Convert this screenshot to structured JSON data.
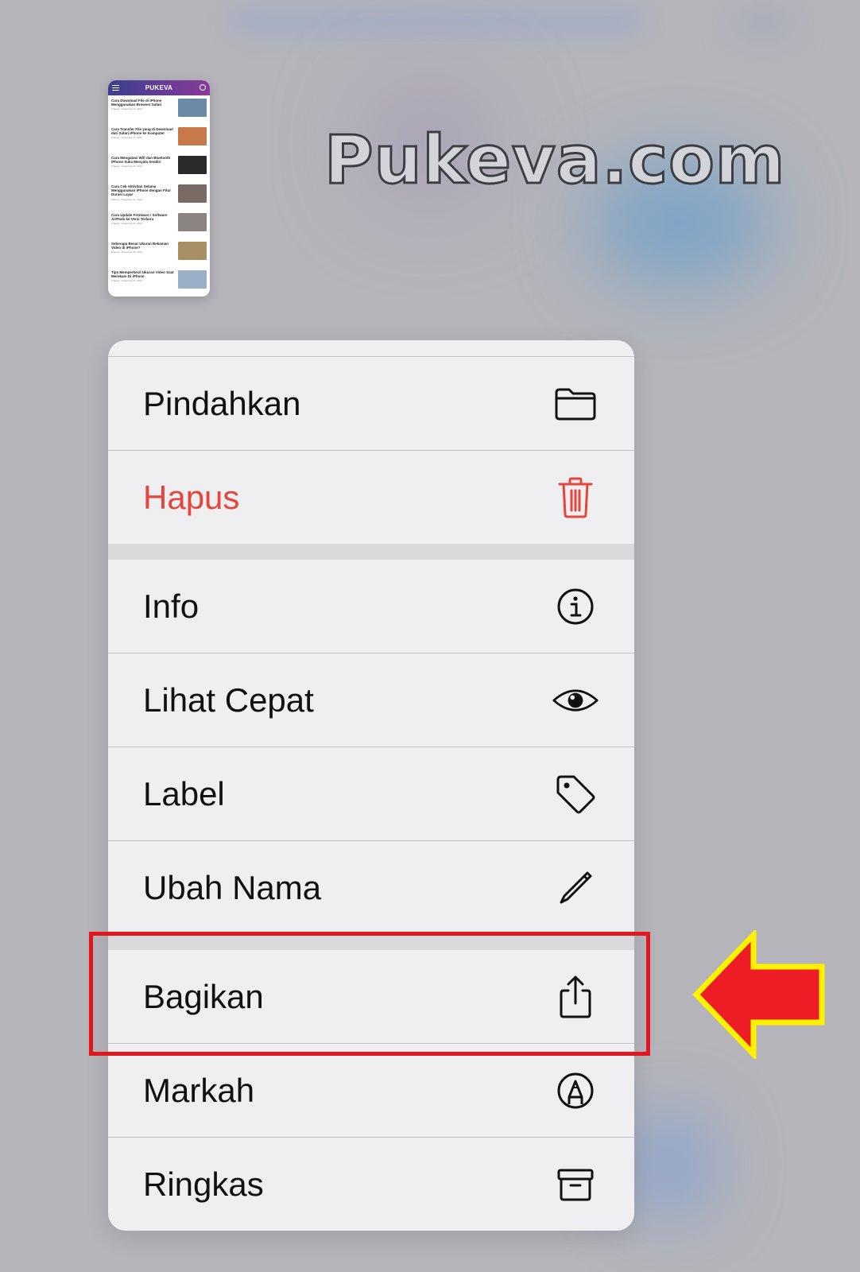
{
  "watermark": "Pukeva.com",
  "thumbnail": {
    "site_name": "PUKEVA",
    "articles": [
      {
        "title": "Cara Download File di iPhone Menggunakan Browser Safari",
        "meta": "Pukeva · Desember 24, 2021",
        "color": "#6a8aa8"
      },
      {
        "title": "Cara Transfer File yang di Download dari Safari iPhone ke Komputer",
        "meta": "Pukeva · Desember 24, 2021",
        "color": "#c8794a"
      },
      {
        "title": "Cara Mengatasi Wifi dan Bluetooth iPhone Suka Menyala Sendiri",
        "meta": "Pukeva · Desember 22, 2021",
        "color": "#2a2a2a"
      },
      {
        "title": "Cara Cek Aktivitas Selama Menggunakan iPhone dengan Fitur Durasi Layar",
        "meta": "Pukeva · Desember 21, 2021",
        "color": "#7a6a64"
      },
      {
        "title": "Cara Update Firmware / Software AirPods ke Versi Terbaru",
        "meta": "Pukeva · Desember 21, 2021",
        "color": "#8a8580"
      },
      {
        "title": "Seberapa Besar Ukuran Rekaman Video di iPhone?",
        "meta": "Pukeva · Desember 20, 2021",
        "color": "#a89064"
      },
      {
        "title": "Tips Memperkecil Ukuran Video Saat Merekam Di iPhone",
        "meta": "Pukeva · Desember 20, 2021",
        "color": "#9ab0c8"
      }
    ]
  },
  "menu": {
    "items": [
      {
        "label": "Pindahkan",
        "icon": "folder-icon"
      },
      {
        "label": "Hapus",
        "icon": "trash-icon",
        "color": "#e5453a"
      },
      {
        "label": "Info",
        "icon": "info-icon"
      },
      {
        "label": "Lihat Cepat",
        "icon": "eye-icon"
      },
      {
        "label": "Label",
        "icon": "tag-icon"
      },
      {
        "label": "Ubah Nama",
        "icon": "pencil-icon"
      },
      {
        "label": "Bagikan",
        "icon": "share-icon"
      },
      {
        "label": "Markah",
        "icon": "markup-icon"
      },
      {
        "label": "Ringkas",
        "icon": "archive-icon"
      }
    ]
  },
  "annotation": {
    "highlight_color": "#e3151d",
    "arrow_fill": "#ee1c24",
    "arrow_outline": "#fff200"
  }
}
